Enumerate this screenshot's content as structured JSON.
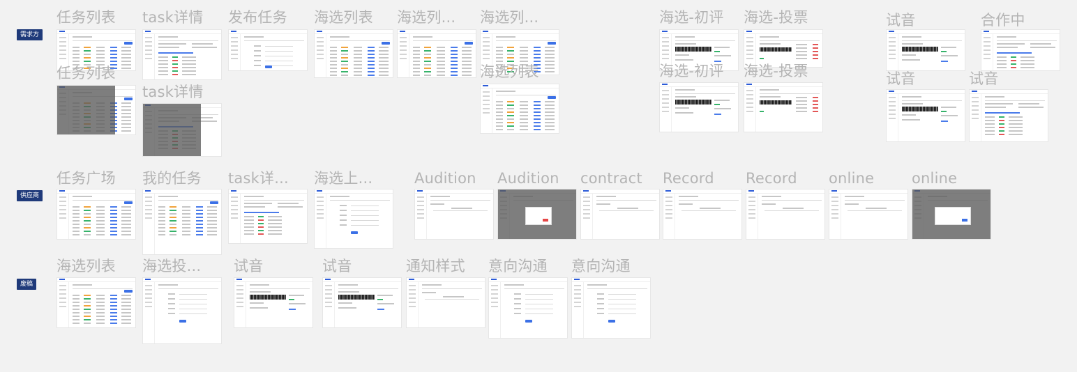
{
  "sections": [
    {
      "label": "需求方",
      "frames": [
        {
          "title": "任务列表",
          "kind": "table"
        },
        {
          "title": "task详情",
          "kind": "detail"
        },
        {
          "title": "发布任务",
          "kind": "form"
        },
        {
          "title": "海选列表",
          "kind": "table"
        },
        {
          "title": "海选列...",
          "kind": "table"
        },
        {
          "title": "海选列...",
          "kind": "table"
        },
        {
          "title": "海选-初评",
          "kind": "audio"
        },
        {
          "title": "海选-投票",
          "kind": "vote"
        },
        {
          "title": "试音",
          "kind": "audio"
        },
        {
          "title": "合作中",
          "kind": "detail"
        },
        {
          "title": "任务列表",
          "kind": "table-overlay"
        },
        {
          "title": "task详情",
          "kind": "detail-overlay"
        },
        {
          "title": "海选列表",
          "kind": "table"
        },
        {
          "title": "海选-初评",
          "kind": "audio"
        },
        {
          "title": "海选-投票",
          "kind": "vote"
        },
        {
          "title": "试音",
          "kind": "audio"
        },
        {
          "title": "试音",
          "kind": "detail"
        }
      ]
    },
    {
      "label": "供应商",
      "frames": [
        {
          "title": "任务广场",
          "kind": "table"
        },
        {
          "title": "我的任务",
          "kind": "table"
        },
        {
          "title": "task详...",
          "kind": "detail"
        },
        {
          "title": "海选上...",
          "kind": "form"
        },
        {
          "title": "Audition",
          "kind": "blank"
        },
        {
          "title": "Audition",
          "kind": "modal"
        },
        {
          "title": "contract",
          "kind": "blank"
        },
        {
          "title": "Record",
          "kind": "blank"
        },
        {
          "title": "Record",
          "kind": "blank"
        },
        {
          "title": "online",
          "kind": "blank"
        },
        {
          "title": "online",
          "kind": "modal-blue"
        }
      ]
    },
    {
      "label": "废稿",
      "frames": [
        {
          "title": "海选列表",
          "kind": "table"
        },
        {
          "title": "海选投...",
          "kind": "form"
        },
        {
          "title": "试音",
          "kind": "audio"
        },
        {
          "title": "试音",
          "kind": "audio"
        },
        {
          "title": "通知样式",
          "kind": "note"
        },
        {
          "title": "意向沟通",
          "kind": "form"
        },
        {
          "title": "意向沟通",
          "kind": "form"
        }
      ]
    }
  ],
  "colors": {
    "background": "#f2f2f2",
    "label_bg": "#1f3a7a",
    "title_text": "#b4b4b4",
    "accent_blue": "#3b70e6"
  }
}
